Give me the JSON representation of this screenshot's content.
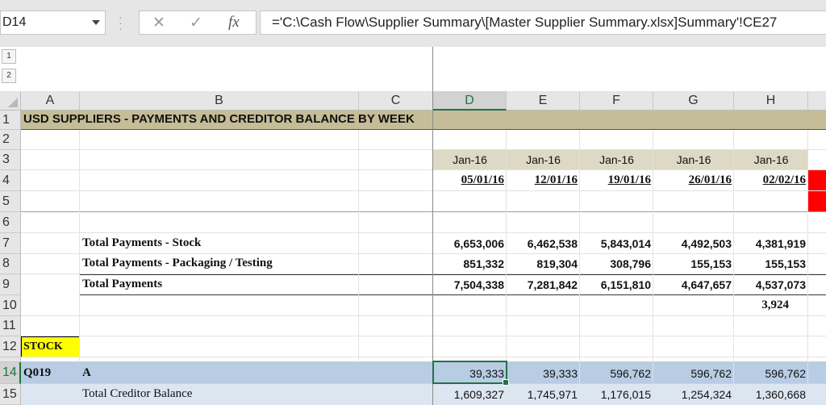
{
  "formula_bar": {
    "name_box": "D14",
    "cancel_icon": "✕",
    "enter_icon": "✓",
    "fx_icon": "fx",
    "formula": "='C:\\Cash Flow\\Supplier Summary\\[Master Supplier Summary.xlsx]Summary'!CE27"
  },
  "outline": {
    "levels": [
      "1",
      "2"
    ]
  },
  "columns": [
    "A",
    "B",
    "C",
    "D",
    "E",
    "F",
    "G",
    "H"
  ],
  "rows": [
    "1",
    "2",
    "3",
    "4",
    "5",
    "6",
    "7",
    "8",
    "9",
    "10",
    "11",
    "12",
    "14",
    "15"
  ],
  "sheet": {
    "title": "USD SUPPLIERS - PAYMENTS AND CREDITOR BALANCE BY WEEK",
    "months": [
      "Jan-16",
      "Jan-16",
      "Jan-16",
      "Jan-16",
      "Jan-16"
    ],
    "weeks": [
      "05/01/16",
      "12/01/16",
      "19/01/16",
      "26/01/16",
      "02/02/16"
    ],
    "payments_stock": {
      "label": "Total Payments - Stock",
      "values": [
        "6,653,006",
        "6,462,538",
        "5,843,014",
        "4,492,503",
        "4,381,919"
      ]
    },
    "payments_packaging": {
      "label": "Total Payments - Packaging / Testing",
      "values": [
        "851,332",
        "819,304",
        "308,796",
        "155,153",
        "155,153"
      ]
    },
    "payments_total": {
      "label": "Total Payments",
      "values": [
        "7,504,338",
        "7,281,842",
        "6,151,810",
        "4,647,657",
        "4,537,073"
      ]
    },
    "row10_h": "3,924",
    "stock_label": "STOCK",
    "supplier": {
      "code": "Q019",
      "name": "A",
      "values": [
        "39,333",
        "39,333",
        "596,762",
        "596,762",
        "596,762"
      ]
    },
    "creditor": {
      "label": "Total Creditor Balance",
      "values": [
        "1,609,327",
        "1,745,971",
        "1,176,015",
        "1,254,324",
        "1,360,668"
      ]
    }
  },
  "colors": {
    "title_fill": "#c4bd97",
    "date_fill": "#ddd9c4",
    "stock_fill": "#ffff00",
    "row14_fill": "#b8cce4",
    "row15_fill": "#dce6f1",
    "red_cell": "#ff0000",
    "selection": "#217346"
  }
}
